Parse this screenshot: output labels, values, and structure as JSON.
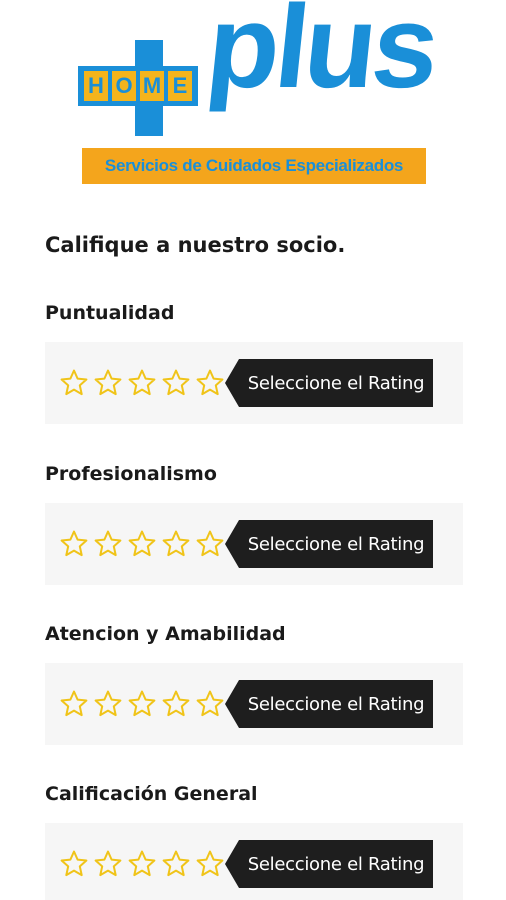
{
  "logo": {
    "home_letters": [
      "H",
      "O",
      "M",
      "E"
    ],
    "plus_text": "plus",
    "tagline": "Servicios de Cuidados Especializados",
    "colors": {
      "blue": "#1a8fd8",
      "orange": "#f4a51c",
      "yellow": "#f4b41c"
    }
  },
  "heading": "Califique a nuestro socio.",
  "rating_tooltip": "Seleccione el Rating",
  "star_color": "#f0c419",
  "categories": [
    {
      "label": "Puntualidad",
      "rating": 0,
      "max": 5
    },
    {
      "label": "Profesionalismo",
      "rating": 0,
      "max": 5
    },
    {
      "label": "Atencion y Amabilidad",
      "rating": 0,
      "max": 5
    },
    {
      "label": "Calificación General",
      "rating": 0,
      "max": 5
    }
  ]
}
